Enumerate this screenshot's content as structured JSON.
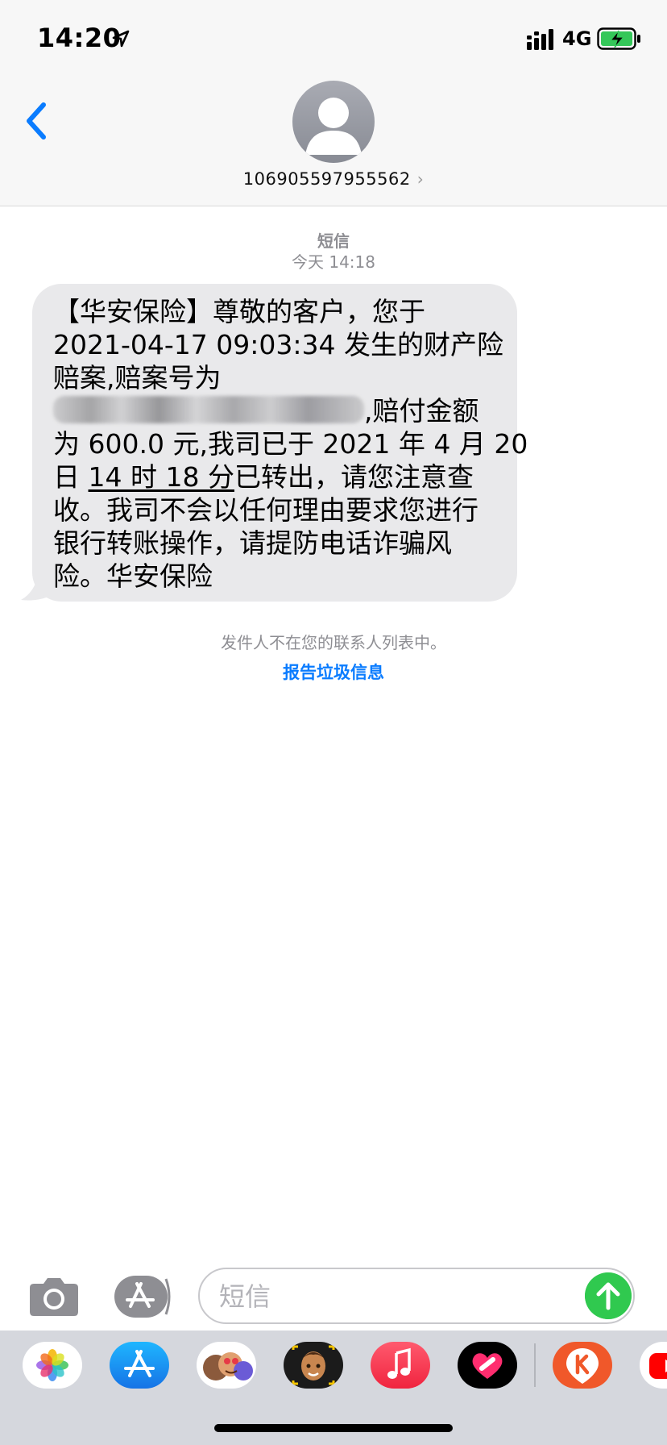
{
  "status_bar": {
    "time": "14:20",
    "network": "4G",
    "icons": [
      "location-arrow-icon",
      "cellular-signal-icon",
      "battery-charging-icon"
    ]
  },
  "header": {
    "back_icon": "chevron-left-icon",
    "avatar_icon": "person-silhouette-icon",
    "contact": "106905597955562",
    "contact_chevron": "›"
  },
  "conversation": {
    "service_label": "短信",
    "timestamp": "今天 14:18",
    "message": {
      "line1": "【华安保险】尊敬的客户，您于",
      "line2": "2021-04-17 09:03:34 发生的财产险",
      "line3": "赔案,赔案号为",
      "line4_suffix": ",赔付金额",
      "line5": "为 600.0 元,我司已于 2021 年 4 月 20",
      "line6_prefix": "日 ",
      "line6_link": "14 时 18 分",
      "line6_suffix": "已转出，请您注意查",
      "line7": "收。我司不会以任何理由要求您进行",
      "line8": "银行转账操作，请提防电话诈骗风",
      "line9": "险。华安保险"
    },
    "notice": "发件人不在您的联系人列表中。",
    "report_link": "报告垃圾信息"
  },
  "input_bar": {
    "placeholder": "短信",
    "value": "",
    "camera_icon": "camera-icon",
    "appstore_icon": "app-store-icon",
    "send_icon": "arrow-up-icon"
  },
  "app_drawer": {
    "apps": [
      "photos-app-icon",
      "app-store-app-icon",
      "memoji-stickers-app-icon",
      "animoji-app-icon",
      "music-app-icon",
      "digital-touch-app-icon",
      "karaoke-app-icon",
      "youtube-app-icon"
    ]
  },
  "colors": {
    "bubble": "#e9e9eb",
    "link": "#0a7cff",
    "send": "#30c94f",
    "nav_bg": "#f7f7f7"
  }
}
